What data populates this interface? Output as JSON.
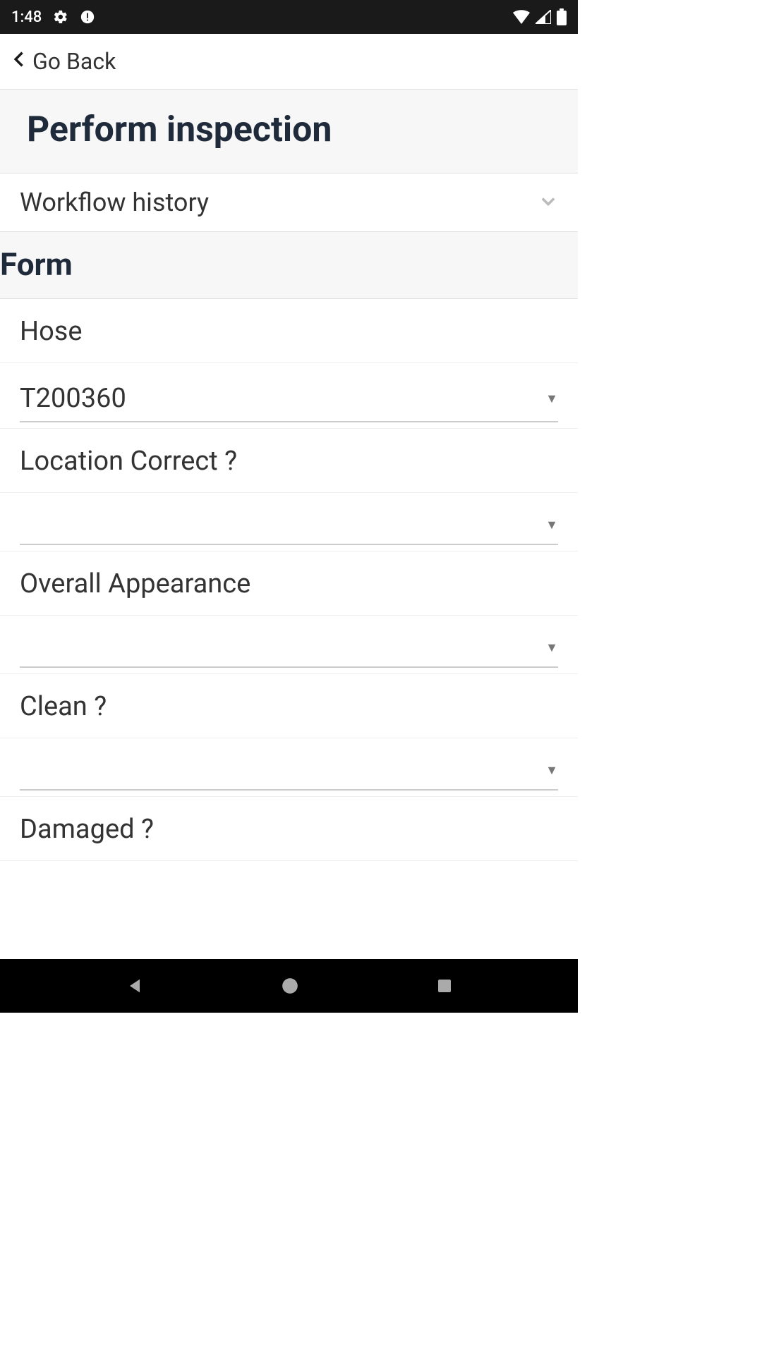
{
  "status_bar": {
    "time": "1:48",
    "icons": {
      "gear": "gear-icon",
      "alert": "alert-circle-icon",
      "wifi": "wifi-icon",
      "signal": "cell-signal-icon",
      "battery": "battery-full-icon"
    }
  },
  "back": {
    "label": "Go Back"
  },
  "page_title": "Perform inspection",
  "accordion": {
    "workflow_history": "Workflow history"
  },
  "section": {
    "form": "Form"
  },
  "fields": [
    {
      "label": "Hose",
      "value": "T200360"
    },
    {
      "label": "Location Correct ?",
      "value": ""
    },
    {
      "label": "Overall Appearance",
      "value": ""
    },
    {
      "label": "Clean ?",
      "value": ""
    },
    {
      "label": "Damaged ?",
      "value": ""
    }
  ],
  "nav": {
    "back": "nav-back",
    "home": "nav-home",
    "recent": "nav-recent"
  }
}
